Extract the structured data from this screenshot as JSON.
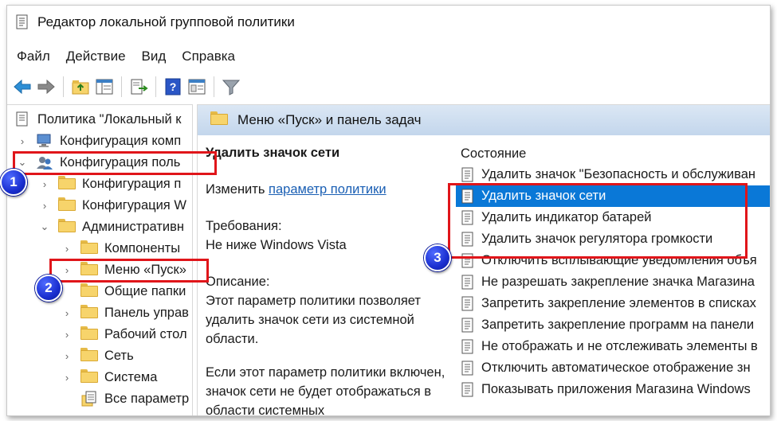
{
  "window": {
    "title": "Редактор локальной групповой политики"
  },
  "menu": [
    "Файл",
    "Действие",
    "Вид",
    "Справка"
  ],
  "toolbar": [
    "back-arrow-icon",
    "forward-arrow-icon",
    "up-folder-icon",
    "show-hide-tree-icon",
    "export-list-icon",
    "help-icon",
    "properties-view-icon",
    "filter-icon"
  ],
  "tree": [
    {
      "label": "Политика \"Локальный к",
      "indent": 0,
      "chev": "",
      "icon": "policy"
    },
    {
      "label": "Конфигурация комп",
      "indent": 1,
      "chev": ">",
      "icon": "computer"
    },
    {
      "label": "Конфигурация поль",
      "indent": 1,
      "chev": "v",
      "icon": "users"
    },
    {
      "label": "Конфигурация п",
      "indent": 2,
      "chev": ">",
      "icon": "folder"
    },
    {
      "label": "Конфигурация W",
      "indent": 2,
      "chev": ">",
      "icon": "folder"
    },
    {
      "label": "Административн",
      "indent": 2,
      "chev": "v",
      "icon": "folder"
    },
    {
      "label": "Компоненты",
      "indent": 3,
      "chev": ">",
      "icon": "folder"
    },
    {
      "label": "Меню «Пуск»",
      "indent": 3,
      "chev": ">",
      "icon": "folder"
    },
    {
      "label": "Общие папки",
      "indent": 3,
      "chev": "",
      "icon": "folder"
    },
    {
      "label": "Панель управ",
      "indent": 3,
      "chev": ">",
      "icon": "folder"
    },
    {
      "label": "Рабочий стол",
      "indent": 3,
      "chev": ">",
      "icon": "folder"
    },
    {
      "label": "Сеть",
      "indent": 3,
      "chev": ">",
      "icon": "folder"
    },
    {
      "label": "Система",
      "indent": 3,
      "chev": ">",
      "icon": "folder"
    },
    {
      "label": "Все параметр",
      "indent": 3,
      "chev": "",
      "icon": "allsettings"
    }
  ],
  "right_header": {
    "title": "Меню «Пуск» и панель задач"
  },
  "details": {
    "title": "Удалить значок сети",
    "edit_prefix": "Изменить",
    "edit_link": "параметр политики",
    "req_label": "Требования:",
    "req_value": "Не ниже Windows Vista",
    "desc_label": "Описание:",
    "desc_text": "Этот параметр политики позволяет удалить значок сети из системной области.",
    "desc_text2": "Если этот параметр политики включен, значок сети не будет отображаться в области системных"
  },
  "list": {
    "column": "Состояние",
    "items": [
      "Удалить значок \"Безопасность и обслуживан",
      "Удалить значок сети",
      "Удалить индикатор батарей",
      "Удалить значок регулятора громкости",
      "Отключить всплывающие уведомления объя",
      "Не разрешать закрепление значка Магазина",
      "Запретить закрепление элементов в списках",
      "Запретить закрепление программ на панели",
      "Не отображать и не отслеживать элементы в",
      "Отключить автоматическое отображение зн",
      "Показывать приложения Магазина Windows"
    ],
    "selected_index": 1
  },
  "annotations": {
    "badge1": "1",
    "badge2": "2",
    "badge3": "3",
    "highlight_color": "#e0151a",
    "badge_color": "#1a2fd0"
  }
}
